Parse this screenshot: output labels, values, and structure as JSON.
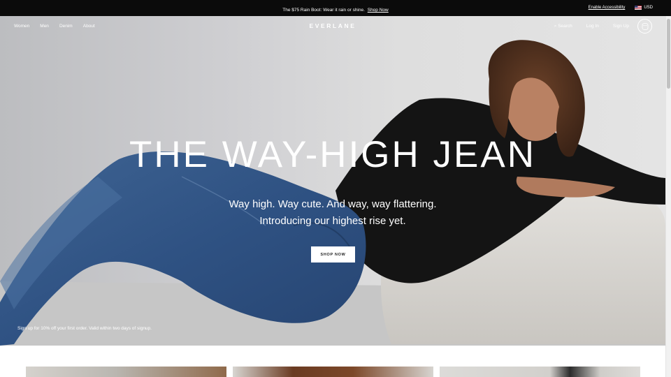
{
  "promo": {
    "text": "The $75 Rain Boot: Wear it rain or shine.",
    "link_label": "Shop Now",
    "accessibility_label": "Enable Accessibility",
    "currency": "USD",
    "flag_icon": "us-flag-icon"
  },
  "nav": {
    "left_items": [
      {
        "label": "Women"
      },
      {
        "label": "Men"
      },
      {
        "label": "Denim"
      },
      {
        "label": "About"
      }
    ],
    "logo": "EVERLANE",
    "search_label": "⌕ Search",
    "login_label": "Log In",
    "signup_label": "Sign Up",
    "cart_icon": "cart-icon"
  },
  "hero": {
    "headline": "THE WAY-HIGH JEAN",
    "subline1": "Way high. Way cute. And way, way flattering.",
    "subline2": "Introducing our highest rise yet.",
    "button_label": "SHOP NOW",
    "signup_note": "Sign up for 10% off your first order. Valid within two days of signup."
  },
  "colors": {
    "promo_bg": "#0b0b0b",
    "text_on_dark": "#ffffff",
    "button_bg": "#ffffff",
    "button_text": "#222222"
  }
}
